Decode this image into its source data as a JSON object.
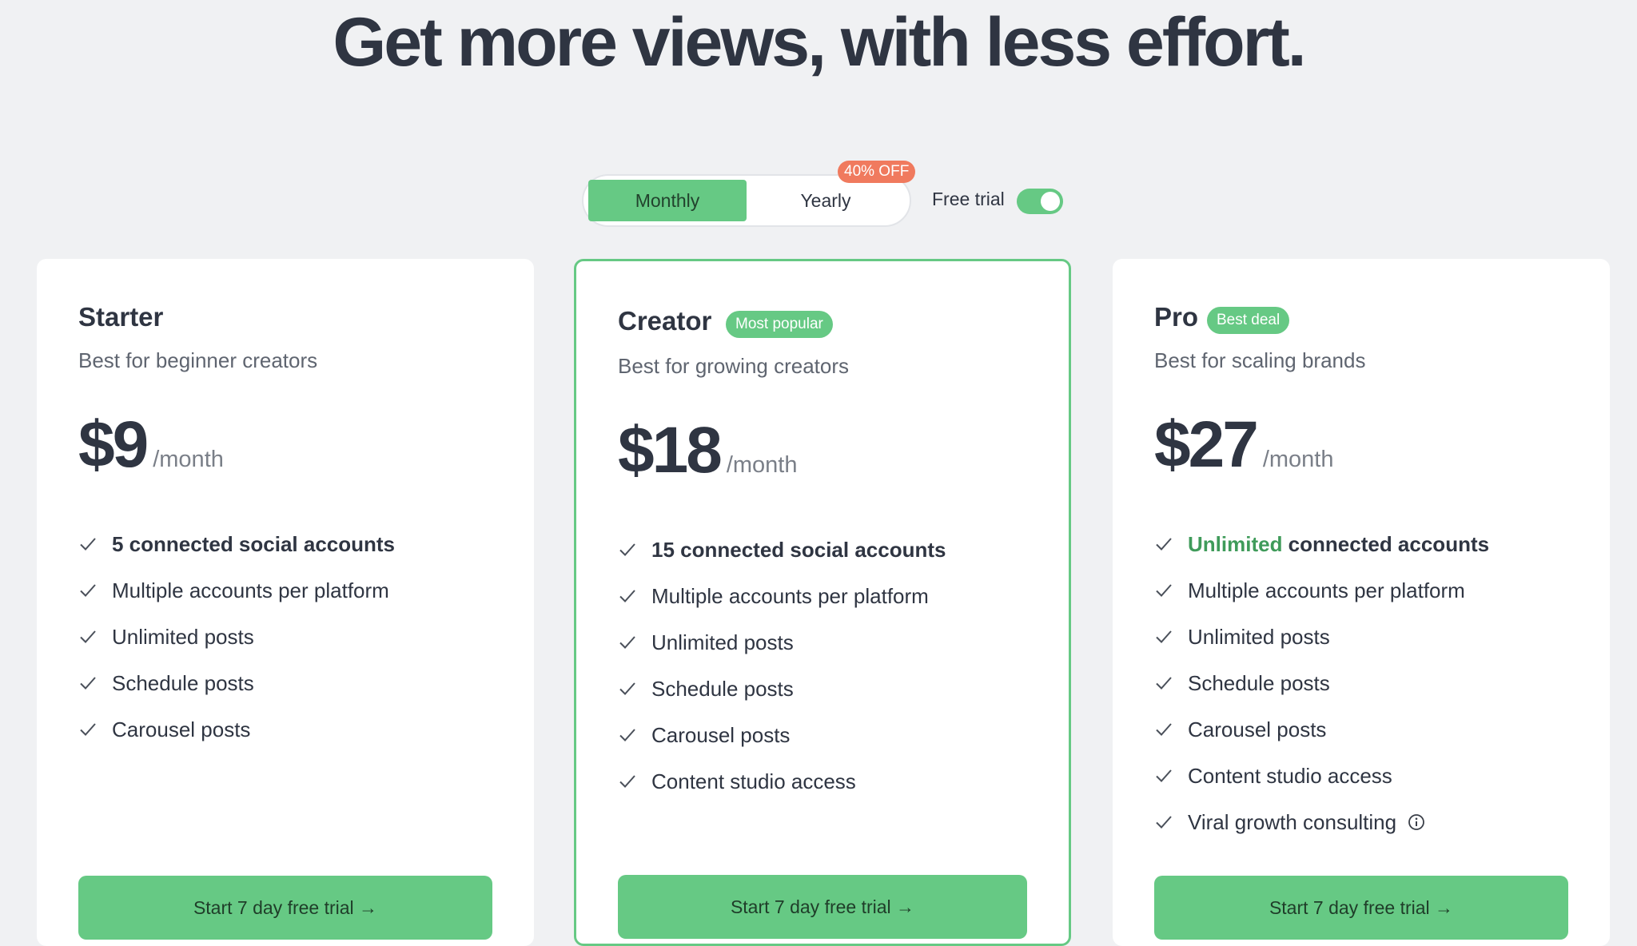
{
  "headline": "Get more views, with less effort.",
  "billing": {
    "monthly_label": "Monthly",
    "yearly_label": "Yearly",
    "selected": "Monthly",
    "discount_badge": "40% OFF",
    "free_trial_label": "Free trial",
    "free_trial_enabled": true
  },
  "colors": {
    "accent": "#66c984",
    "discount": "#f07a5e",
    "text": "#2f3542"
  },
  "plans": [
    {
      "name": "Starter",
      "badge": "",
      "description": "Best for beginner creators",
      "price": "$9",
      "period": "/month",
      "features": [
        "5 connected social accounts",
        "Multiple accounts per platform",
        "Unlimited posts",
        "Schedule posts",
        "Carousel posts"
      ],
      "cta": "Start 7 day free trial →"
    },
    {
      "name": "Creator",
      "badge": "Most popular",
      "description": "Best for growing creators",
      "price": "$18",
      "period": "/month",
      "features": [
        "15 connected social accounts",
        "Multiple accounts per platform",
        "Unlimited posts",
        "Schedule posts",
        "Carousel posts",
        "Content studio access"
      ],
      "cta": "Start 7 day free trial →"
    },
    {
      "name": "Pro",
      "badge": "Best deal",
      "description": "Best for scaling brands",
      "price": "$27",
      "period": "/month",
      "features_first_highlight": "Unlimited",
      "features_first_rest": " connected accounts",
      "features": [
        "Multiple accounts per platform",
        "Unlimited posts",
        "Schedule posts",
        "Carousel posts",
        "Content studio access",
        "Viral growth consulting"
      ],
      "cta": "Start 7 day free trial →"
    }
  ]
}
